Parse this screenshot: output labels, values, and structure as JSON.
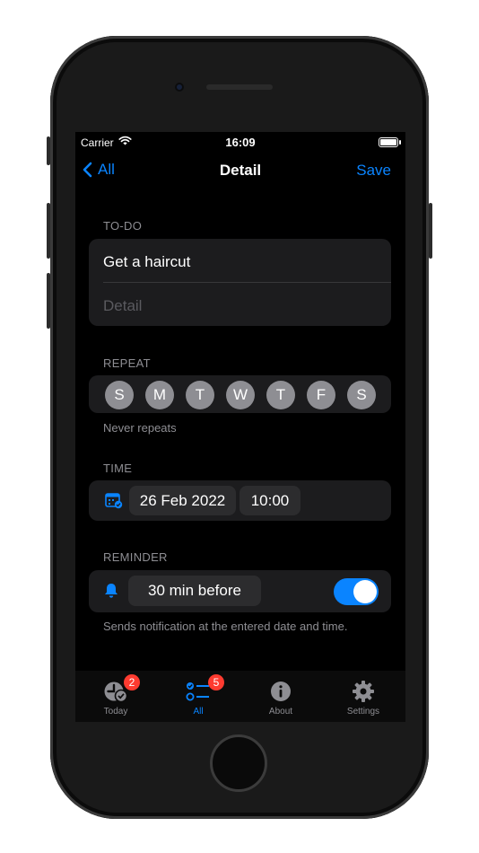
{
  "status_bar": {
    "carrier": "Carrier",
    "time": "16:09"
  },
  "nav": {
    "back_label": "All",
    "title": "Detail",
    "save_label": "Save"
  },
  "todo": {
    "section_label": "TO-DO",
    "title_value": "Get a haircut",
    "detail_placeholder": "Detail"
  },
  "repeat": {
    "section_label": "REPEAT",
    "days": [
      "S",
      "M",
      "T",
      "W",
      "T",
      "F",
      "S"
    ],
    "hint": "Never repeats"
  },
  "time": {
    "section_label": "TIME",
    "date": "26 Feb 2022",
    "time": "10:00"
  },
  "reminder": {
    "section_label": "REMINDER",
    "offset": "30 min before",
    "hint": "Sends notification at the entered date and time.",
    "enabled": true
  },
  "tabs": [
    {
      "label": "Today",
      "icon": "clock-check-icon",
      "badge": "2"
    },
    {
      "label": "All",
      "icon": "checklist-icon",
      "badge": "5"
    },
    {
      "label": "About",
      "icon": "info-icon"
    },
    {
      "label": "Settings",
      "icon": "gear-icon"
    }
  ],
  "colors": {
    "accent": "#0a84ff",
    "badge": "#ff3b30",
    "card": "#1c1c1e"
  }
}
